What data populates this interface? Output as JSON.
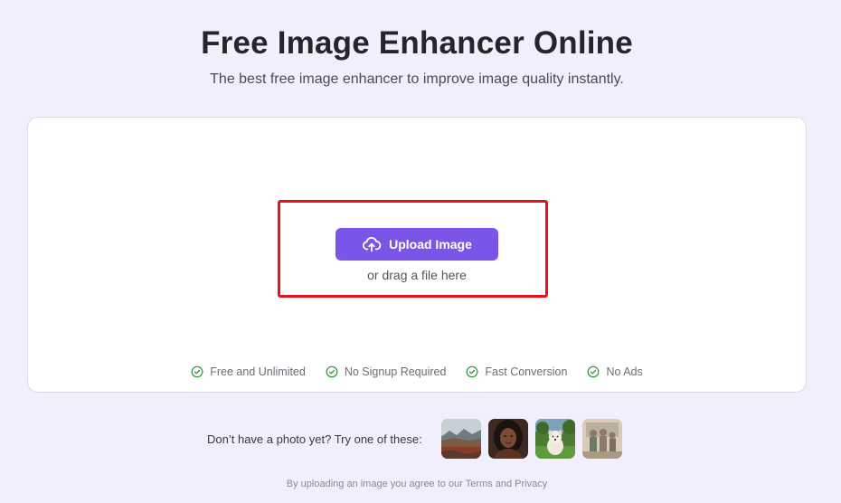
{
  "header": {
    "title": "Free Image Enhancer Online",
    "subtitle": "The best free image enhancer to improve image quality instantly."
  },
  "upload": {
    "button_label": "Upload Image",
    "button_icon": "cloud-upload-icon",
    "drag_hint": "or drag a file here",
    "accent_color": "#7b55e8",
    "highlight_color": "#e8121b"
  },
  "features": [
    {
      "label": "Free and Unlimited",
      "icon": "check-circle-icon"
    },
    {
      "label": "No Signup Required",
      "icon": "check-circle-icon"
    },
    {
      "label": "Fast Conversion",
      "icon": "check-circle-icon"
    },
    {
      "label": "No Ads",
      "icon": "check-circle-icon"
    }
  ],
  "samples": {
    "label": "Don’t have a photo yet? Try one of these:",
    "thumbnails": [
      {
        "name": "landscape"
      },
      {
        "name": "portrait"
      },
      {
        "name": "dog"
      },
      {
        "name": "family"
      }
    ]
  },
  "legal": {
    "prefix": "By uploading an image you agree to our",
    "terms": "Terms",
    "and": "and",
    "privacy": "Privacy"
  },
  "colors": {
    "page_background": "#f1effc",
    "feature_check": "#3b9a3b"
  }
}
